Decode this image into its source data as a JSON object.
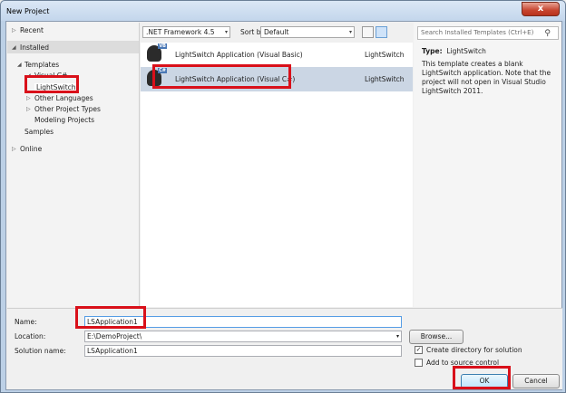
{
  "window": {
    "title": "New Project",
    "close_glyph": "x"
  },
  "nav": {
    "recent": "Recent",
    "installed": "Installed",
    "templates": "Templates",
    "visual_cs": "Visual C#",
    "lightswitch": "LightSwitch",
    "other_languages": "Other Languages",
    "other_project_types": "Other Project Types",
    "modeling_projects": "Modeling Projects",
    "samples": "Samples",
    "online": "Online"
  },
  "toolbar": {
    "framework": ".NET Framework 4.5",
    "sort_label": "Sort by:",
    "sort_value": "Default"
  },
  "templates": [
    {
      "name": "LightSwitch Application (Visual Basic)",
      "lang": "LightSwitch",
      "tag": "VB"
    },
    {
      "name": "LightSwitch Application (Visual C#)",
      "lang": "LightSwitch",
      "tag": "C#"
    }
  ],
  "details": {
    "search_placeholder": "Search Installed Templates (Ctrl+E)",
    "type_label": "Type:",
    "type_value": "LightSwitch",
    "description": "This template creates a blank LightSwitch application. Note that the project will not open in Visual Studio LightSwitch 2011."
  },
  "form": {
    "name_label": "Name:",
    "name_value": "LSApplication1",
    "location_label": "Location:",
    "location_value": "E:\\DemoProject\\",
    "solution_label": "Solution name:",
    "solution_value": "LSApplication1",
    "browse": "Browse...",
    "create_dir": "Create directory for solution",
    "add_source": "Add to source control",
    "ok": "OK",
    "cancel": "Cancel"
  },
  "colors": {
    "highlight": "#d9101a",
    "selection": "#cbd6e4"
  },
  "icons": [
    "close-icon",
    "search-icon",
    "expand-arrow-icon",
    "collapse-arrow-icon",
    "dropdown-icon",
    "grid-view-icon",
    "list-view-icon",
    "lightswitch-icon"
  ]
}
